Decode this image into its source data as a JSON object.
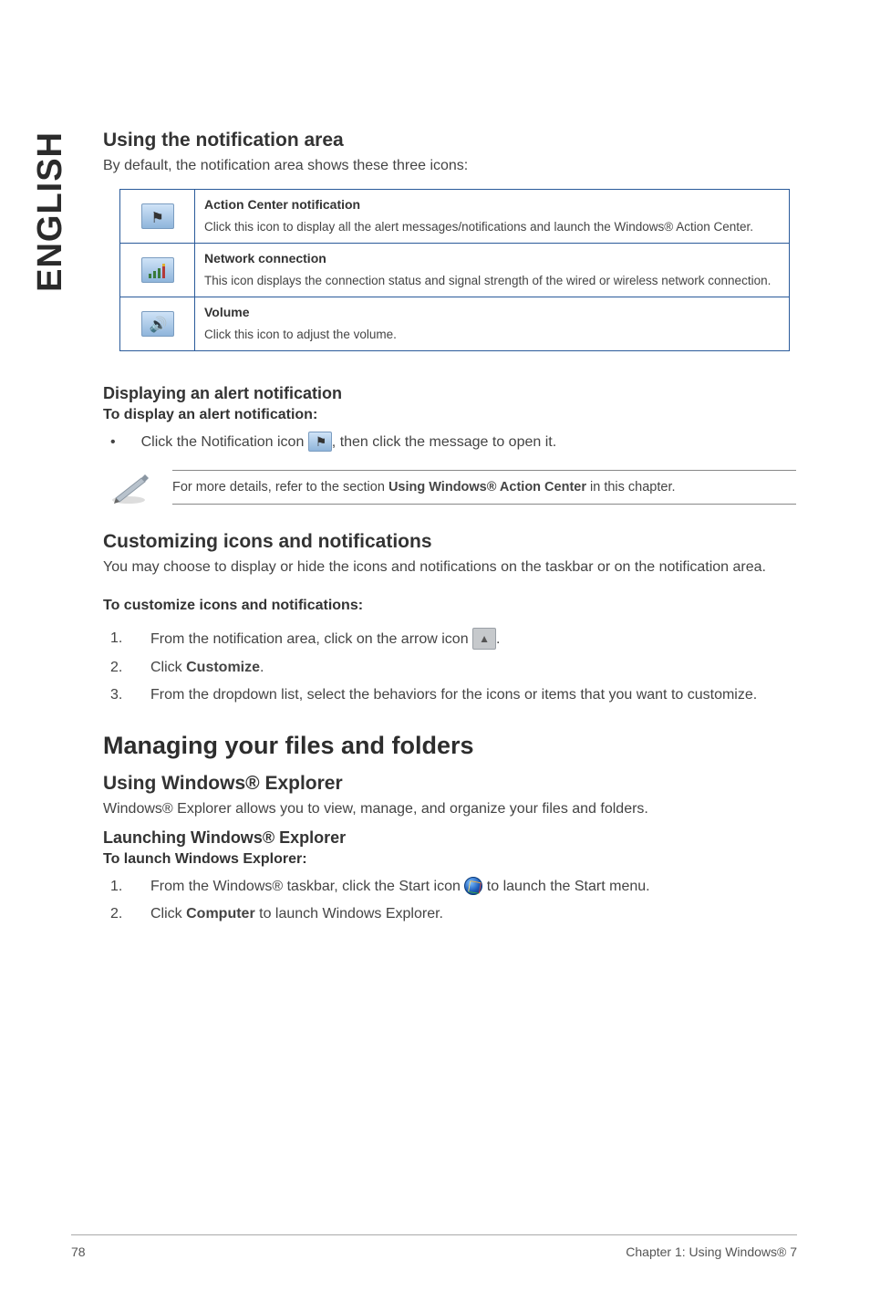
{
  "sidebar_label": "ENGLISH",
  "section1": {
    "heading": "Using the notification area",
    "intro": "By default, the notification area shows these three icons:"
  },
  "icon_table": [
    {
      "title": "Action Center notification",
      "body": "Click this icon to display all the alert messages/notifications and launch the Windows® Action Center."
    },
    {
      "title": "Network connection",
      "body": "This icon displays the connection status and signal strength of the wired or wireless network connection."
    },
    {
      "title": "Volume",
      "body": "Click this icon to adjust the volume."
    }
  ],
  "alert_section": {
    "heading": "Displaying an alert notification",
    "subheading": "To display an alert notification:",
    "bullet_pre": "Click the Notification icon ",
    "bullet_post": ", then click the message to open it."
  },
  "note": {
    "pre": "For more details, refer to the section ",
    "bold": "Using Windows® Action Center",
    "post": " in this chapter."
  },
  "customize": {
    "heading": "Customizing icons and notifications",
    "intro": "You may choose to display or hide the icons and notifications on the taskbar or on the notification area.",
    "subheading": "To customize icons and notifications:",
    "steps": [
      {
        "pre": "From the notification area, click on the arrow icon ",
        "post": "."
      },
      {
        "bold": "Customize",
        "pre": "Click ",
        "post": "."
      },
      {
        "text": "From the dropdown list, select the behaviors for the icons or items that you want to customize."
      }
    ]
  },
  "manage": {
    "heading": "Managing your files and folders",
    "explorer_heading": "Using Windows® Explorer",
    "explorer_intro": "Windows® Explorer allows you to view, manage, and organize your files and folders.",
    "launch_heading": "Launching Windows® Explorer",
    "launch_sub": "To launch Windows Explorer:",
    "steps": [
      {
        "pre": "From the Windows® taskbar, click the Start icon ",
        "post": " to launch the Start menu."
      },
      {
        "pre": "Click ",
        "bold": "Computer",
        "post": " to launch Windows Explorer."
      }
    ]
  },
  "footer": {
    "page": "78",
    "chapter": "Chapter 1: Using Windows® 7"
  }
}
